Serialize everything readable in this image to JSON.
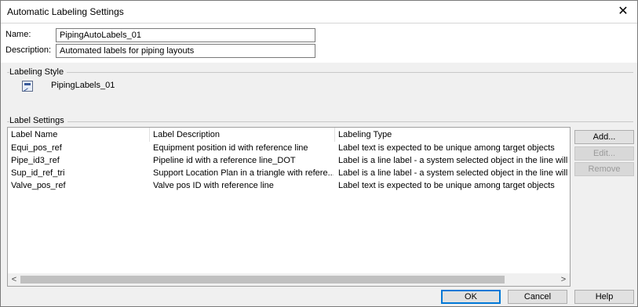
{
  "window": {
    "title": "Automatic Labeling Settings",
    "close_glyph": "✕"
  },
  "form": {
    "name_label": "Name:",
    "name_value": "PipingAutoLabels_01",
    "description_label": "Description:",
    "description_value": "Automated labels for piping layouts"
  },
  "labeling_style": {
    "group_title": "Labeling Style",
    "icon": "labeling-style-icon",
    "name": "PipingLabels_01"
  },
  "label_settings": {
    "group_title": "Label Settings",
    "columns": [
      "Label Name",
      "Label Description",
      "Labeling Type"
    ],
    "rows": [
      [
        "Equi_pos_ref",
        "Equipment position id with reference line",
        "Label text is expected to be unique among target objects"
      ],
      [
        "Pipe_id3_ref",
        "Pipeline id with a reference line_DOT",
        "Label is a line label - a system selected object in the line will l"
      ],
      [
        "Sup_id_ref_tri",
        "Support Location Plan in a triangle with refere...",
        "Label is a line label - a system selected object in the line will l"
      ],
      [
        "Valve_pos_ref",
        "Valve pos ID with reference line",
        "Label text is expected to be unique among target objects"
      ]
    ],
    "scroll_left": "<",
    "scroll_right": ">"
  },
  "side_buttons": {
    "add": "Add...",
    "edit": "Edit...",
    "remove": "Remove"
  },
  "footer": {
    "ok": "OK",
    "cancel": "Cancel",
    "help": "Help"
  }
}
